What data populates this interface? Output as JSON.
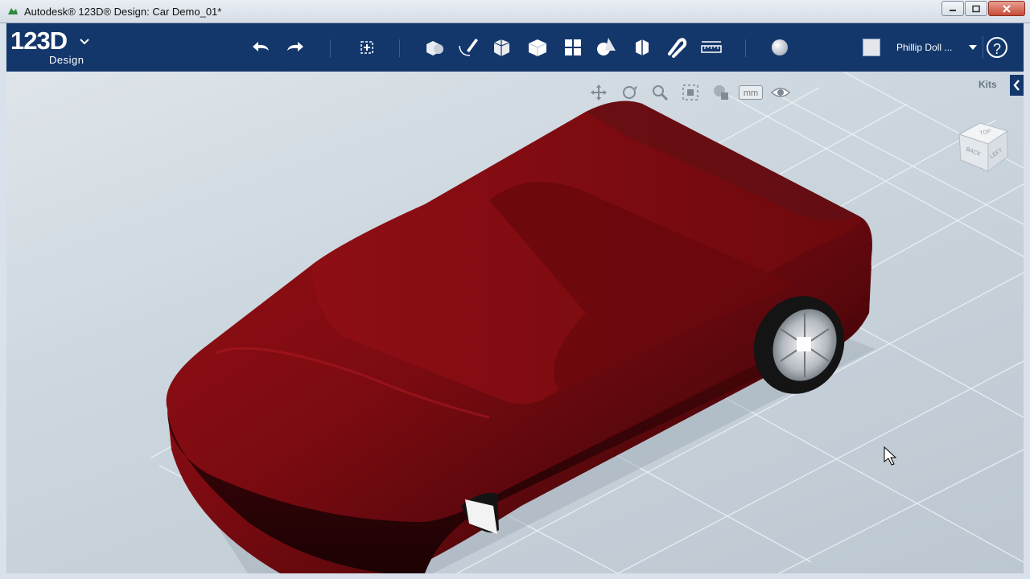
{
  "window": {
    "title": "Autodesk® 123D® Design: Car Demo_01*",
    "controls": [
      "minimize-icon",
      "maximize-icon",
      "close-icon"
    ]
  },
  "toolbar": {
    "logo_brand": "123D",
    "logo_sub": "Design",
    "tools": [
      "undo-icon",
      "redo-icon",
      "transform-icon",
      "primitives-icon",
      "sketch-icon",
      "construct-icon",
      "modify-icon",
      "pattern-icon",
      "group-icon",
      "combine-icon",
      "snap-icon",
      "measure-icon",
      "material-icon"
    ],
    "user_name": "Phillip Doll ...",
    "help_label": "?"
  },
  "viewport": {
    "nav_tools": [
      "pan-icon",
      "orbit-icon",
      "zoom-icon",
      "fit-icon",
      "visibility-style-icon"
    ],
    "units_label": "mm",
    "eye_icon": "eye-icon",
    "kits_label": "Kits",
    "viewcube_faces": [
      "TOP",
      "BACK",
      "LEFT"
    ],
    "model_color": "#7a0a10",
    "accent": "#13376b"
  }
}
